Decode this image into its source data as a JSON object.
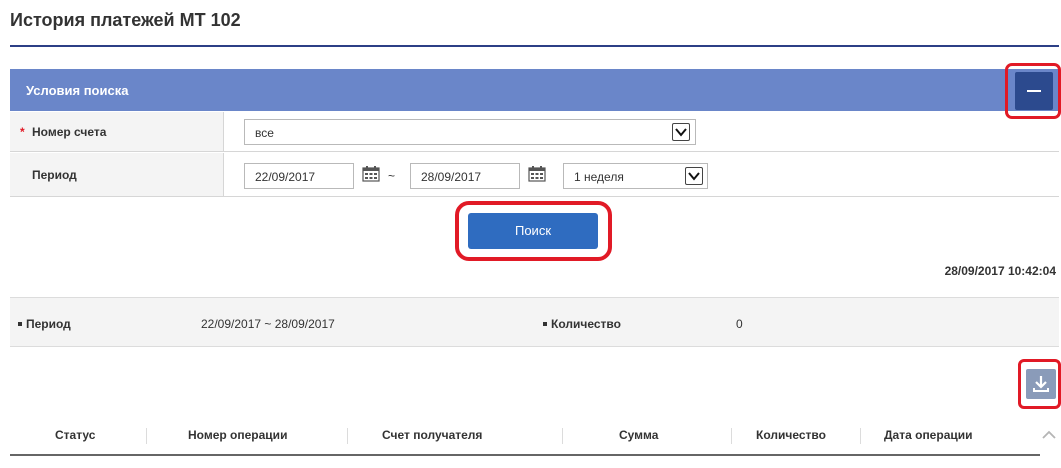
{
  "page": {
    "title": "История платежей МТ 102"
  },
  "search_panel": {
    "title": "Условия поиска",
    "account": {
      "label": "Номер счета",
      "required_mark": "*",
      "value": "все"
    },
    "period": {
      "label": "Период",
      "from": "22/09/2017",
      "separator": "~",
      "to": "28/09/2017",
      "range": "1 неделя"
    },
    "search_button": "Поиск"
  },
  "timestamp": "28/09/2017 10:42:04",
  "summary": {
    "period_label": "Период",
    "period_value": "22/09/2017 ~ 28/09/2017",
    "count_label": "Количество",
    "count_value": "0"
  },
  "table": {
    "columns": [
      "Статус",
      "Номер операции",
      "Счет получателя",
      "Сумма",
      "Количество",
      "Дата операции"
    ]
  },
  "colors": {
    "header_bar": "#6a86c9",
    "primary_button": "#2f6cc0",
    "highlight": "#e11a26",
    "title_rule": "#2c3f86"
  }
}
